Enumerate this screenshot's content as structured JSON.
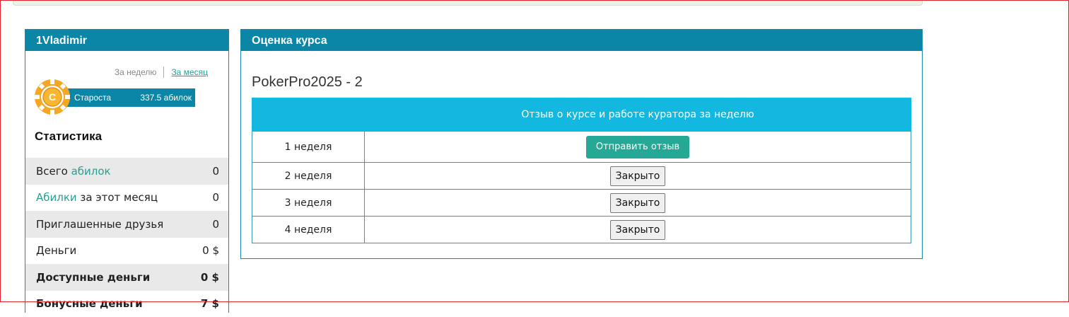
{
  "profile": {
    "username": "1Vladimir",
    "period_tabs": [
      {
        "label": "За неделю",
        "active": false
      },
      {
        "label": "За месяц",
        "active": true
      }
    ],
    "rank": {
      "coin_letter": "С",
      "name": "Староста",
      "points": "337.5 абилок"
    },
    "stats_title": "Статистика",
    "stats": [
      {
        "prefix": "Всего ",
        "link": "абилок",
        "suffix": "",
        "value": "0"
      },
      {
        "prefix": "",
        "link": "Абилки",
        "suffix": " за этот месяц",
        "value": "0"
      },
      {
        "prefix": "Приглашенные друзья",
        "link": "",
        "suffix": "",
        "value": "0"
      },
      {
        "prefix": "Деньги",
        "link": "",
        "suffix": "",
        "value": "0 $"
      },
      {
        "prefix": "Доступные деньги",
        "link": "",
        "suffix": "",
        "value": "0 $"
      },
      {
        "prefix": "Бонусные деньги",
        "link": "",
        "suffix": "",
        "value": "7 $"
      }
    ]
  },
  "rating": {
    "title": "Оценка курса",
    "course_name": "PokerPro2025 - 2",
    "table_header": {
      "week": "",
      "review": "Отзыв о курсе и работе куратора за неделю"
    },
    "weeks": [
      {
        "label": "1 неделя",
        "action": "Отправить отзыв",
        "state": "open"
      },
      {
        "label": "2 неделя",
        "action": "Закрыто",
        "state": "closed"
      },
      {
        "label": "3 неделя",
        "action": "Закрыто",
        "state": "closed"
      },
      {
        "label": "4 неделя",
        "action": "Закрыто",
        "state": "closed"
      }
    ]
  },
  "colors": {
    "header_bg": "#0b86a6",
    "table_header_bg": "#13b8e0",
    "link": "#2a9d93",
    "send_button": "#26a896",
    "coin": "#f5a623"
  }
}
